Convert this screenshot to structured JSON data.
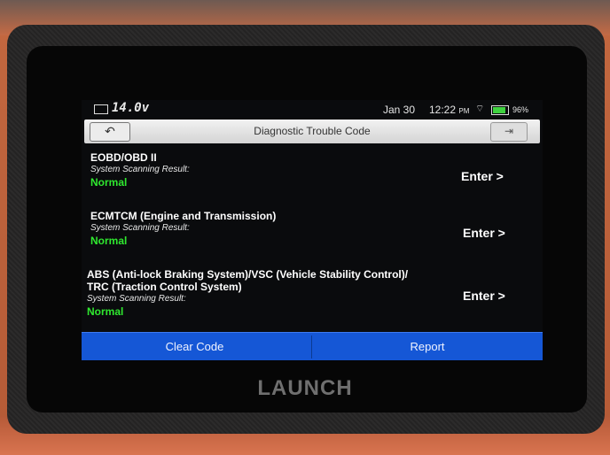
{
  "status_bar": {
    "voltage": "14.0v",
    "date": "Jan 30",
    "time": "12:22",
    "time_suffix": "PM",
    "battery_percent": "96%"
  },
  "header": {
    "title": "Diagnostic Trouble Code",
    "back_label": "↶",
    "exit_label": "⇥"
  },
  "entries": [
    {
      "name_line1": "EOBD/OBD II",
      "name_line2": "",
      "sub": "System Scanning Result:",
      "status": "Normal",
      "enter": "Enter >"
    },
    {
      "name_line1": "ECMTCM (Engine and Transmission)",
      "name_line2": "",
      "sub": "System Scanning Result:",
      "status": "Normal",
      "enter": "Enter >"
    },
    {
      "name_line1": "ABS (Anti-lock Braking System)/VSC (Vehicle Stability Control)/",
      "name_line2": "TRC (Traction Control System)",
      "sub": "System Scanning Result:",
      "status": "Normal",
      "enter": "Enter >"
    }
  ],
  "actions": {
    "clear_code": "Clear Code",
    "report": "Report"
  },
  "device": {
    "brand": "LAUNCH"
  },
  "colors": {
    "status_ok": "#2fe82f",
    "action_bar": "#1557d6"
  }
}
